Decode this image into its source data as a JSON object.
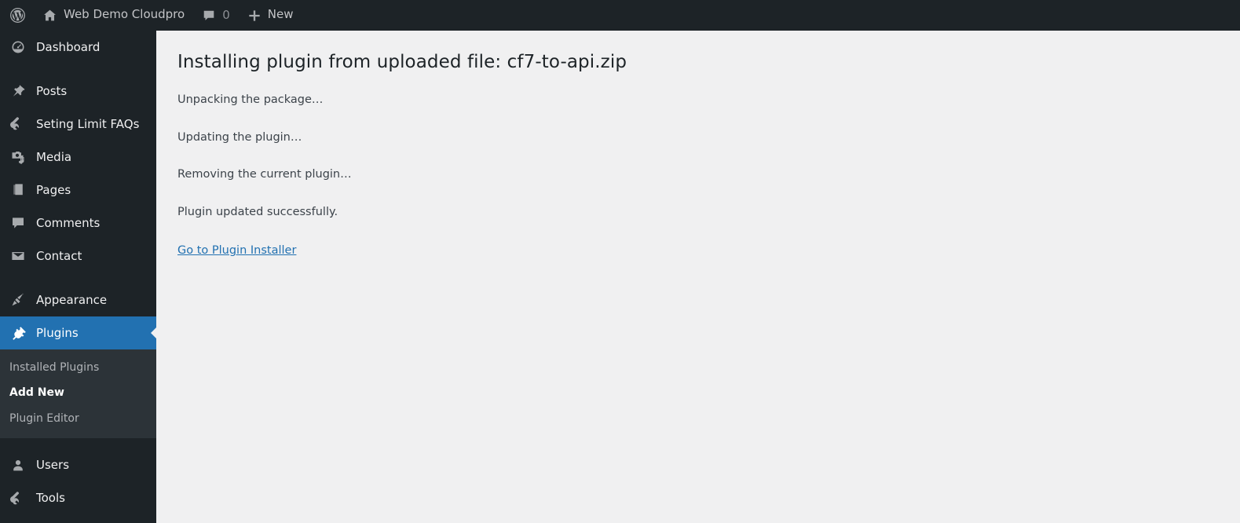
{
  "adminbar": {
    "wp_logo_icon": "wordpress-logo-icon",
    "site_home_icon": "home-icon",
    "site_name": "Web Demo Cloudpro",
    "comments_icon": "comment-bubble-icon",
    "comments_count": "0",
    "new_icon": "plus-icon",
    "new_label": "New"
  },
  "sidebar": {
    "groups": [
      {
        "items": [
          {
            "label": "Dashboard",
            "icon": "dashboard-gauge-icon",
            "current": false
          }
        ]
      },
      {
        "items": [
          {
            "label": "Posts",
            "icon": "pushpin-icon",
            "current": false
          },
          {
            "label": "Seting Limit FAQs",
            "icon": "wrench-icon",
            "current": false
          },
          {
            "label": "Media",
            "icon": "media-camera-music-icon",
            "current": false
          },
          {
            "label": "Pages",
            "icon": "pages-stack-icon",
            "current": false
          },
          {
            "label": "Comments",
            "icon": "comment-bubble-icon",
            "current": false
          },
          {
            "label": "Contact",
            "icon": "envelope-icon",
            "current": false
          }
        ]
      },
      {
        "items": [
          {
            "label": "Appearance",
            "icon": "paintbrush-icon",
            "current": false
          },
          {
            "label": "Plugins",
            "icon": "plug-icon",
            "current": true
          }
        ]
      },
      {
        "items": [
          {
            "label": "Users",
            "icon": "user-icon",
            "current": false
          },
          {
            "label": "Tools",
            "icon": "wrench-icon",
            "current": false
          }
        ]
      }
    ],
    "submenu": {
      "parent": "Plugins",
      "items": [
        {
          "label": "Installed Plugins",
          "current": false
        },
        {
          "label": "Add New",
          "current": true
        },
        {
          "label": "Plugin Editor",
          "current": false
        }
      ]
    }
  },
  "main": {
    "title": "Installing plugin from uploaded file: cf7-to-api.zip",
    "lines": [
      "Unpacking the package…",
      "Updating the plugin…",
      "Removing the current plugin…",
      "Plugin updated successfully."
    ],
    "link_label": "Go to Plugin Installer"
  },
  "colors": {
    "admin_dark": "#1d2327",
    "submenu_dark": "#2c3338",
    "accent_blue": "#2271b1",
    "content_bg": "#f0f0f1",
    "link_blue": "#2271b1"
  }
}
